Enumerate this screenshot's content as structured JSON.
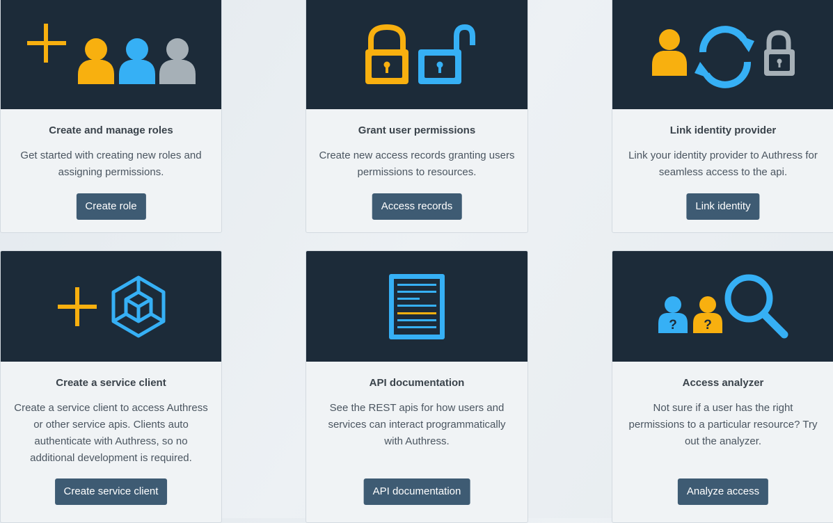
{
  "cards": [
    {
      "title": "Create and manage roles",
      "desc": "Get started with creating new roles and assigning permissions.",
      "button": "Create role"
    },
    {
      "title": "Grant user permissions",
      "desc": "Create new access records granting users permissions to resources.",
      "button": "Access records"
    },
    {
      "title": "Link identity provider",
      "desc": "Link your identity provider to Authress for seamless access to the api.",
      "button": "Link identity"
    },
    {
      "title": "Create a service client",
      "desc": "Create a service client to access Authress or other service apis. Clients auto authenticate with Authress, so no additional development is required.",
      "button": "Create service client"
    },
    {
      "title": "API documentation",
      "desc": "See the REST apis for how users and services can interact programmatically with Authress.",
      "button": "API documentation"
    },
    {
      "title": "Access analyzer",
      "desc": "Not sure if a user has the right permissions to a particular resource? Try out the analyzer.",
      "button": "Analyze access"
    }
  ],
  "colors": {
    "banner": "#1c2b39",
    "orange": "#f8b00f",
    "blue": "#36b0f5",
    "gray": "#a6b0b7",
    "button": "#3e5b73"
  }
}
